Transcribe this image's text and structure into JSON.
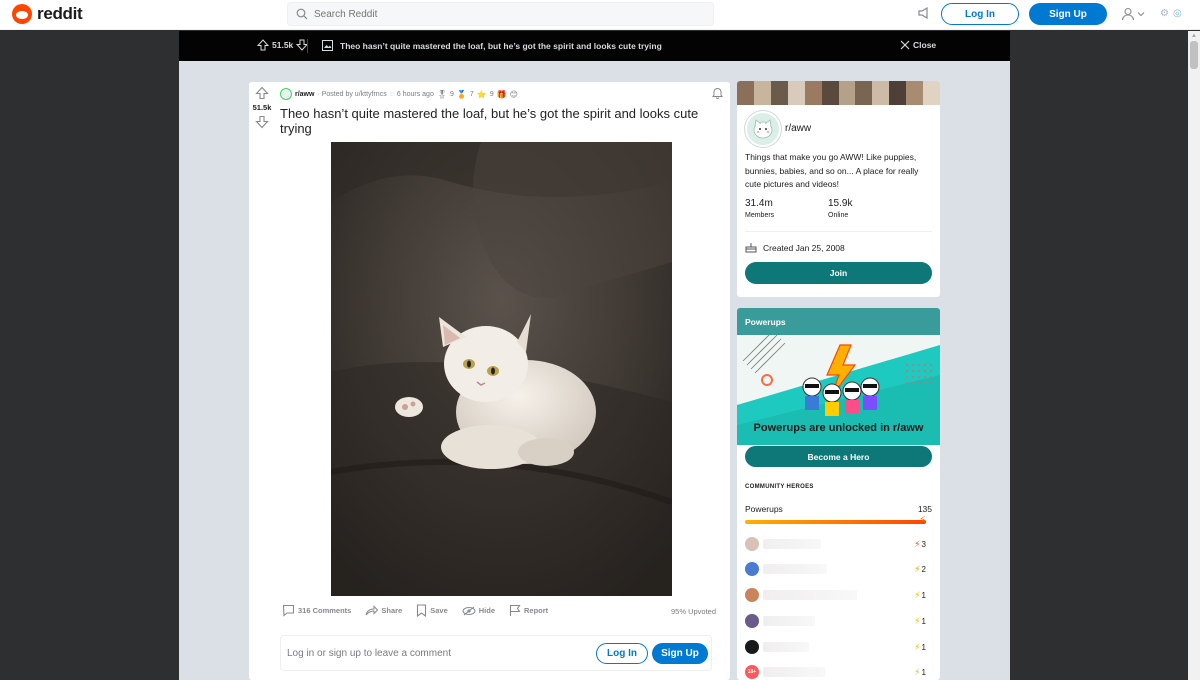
{
  "header": {
    "logo_text": "reddit",
    "search_placeholder": "Search Reddit",
    "login_label": "Log In",
    "signup_label": "Sign Up"
  },
  "postbar": {
    "votes": "51.5k",
    "title": "Theo hasn’t quite mastered the loaf, but he’s got the spirit and looks cute trying",
    "close_label": "Close"
  },
  "post": {
    "votes": "51.5k",
    "subreddit": "r/aww",
    "posted_by": "· Posted by u/kttyfrncs",
    "time": "6 hours ago",
    "awards": [
      {
        "icon": "award-1-icon",
        "count": "9"
      },
      {
        "icon": "award-2-icon",
        "count": "7"
      },
      {
        "icon": "award-3-icon",
        "count": "9"
      }
    ],
    "title": "Theo hasn’t quite mastered the loaf, but he’s got the spirit and looks cute trying",
    "actions": {
      "comments": "316 Comments",
      "share": "Share",
      "save": "Save",
      "hide": "Hide",
      "report": "Report"
    },
    "upvoted": "95% Upvoted",
    "comment_prompt": "Log in or sign up to leave a comment",
    "login_label": "Log In",
    "signup_label": "Sign Up"
  },
  "community": {
    "name": "r/aww",
    "description": "Things that make you go AWW! Like puppies, bunnies, babies, and so on... A place for really cute pictures and videos!",
    "members_value": "31.4m",
    "members_label": "Members",
    "online_value": "15.9k",
    "online_label": "Online",
    "created": "Created Jan 25, 2008",
    "join_label": "Join"
  },
  "powerups": {
    "title": "Powerups",
    "unlocked_text": "Powerups are unlocked in r/aww",
    "hero_button": "Become a Hero",
    "heroes_title": "COMMUNITY HEROES",
    "row_label": "Powerups",
    "row_value": "135",
    "progress": 1.0,
    "heroes": [
      {
        "count": "3",
        "avatar_color": "#d9c2b5"
      },
      {
        "count": "2",
        "avatar_color": "#4a7bd1"
      },
      {
        "count": "1",
        "avatar_color": "#c9845a"
      },
      {
        "count": "1",
        "avatar_color": "#6b5b8a"
      },
      {
        "count": "1",
        "avatar_color": "#1a1a1a"
      },
      {
        "count": "1",
        "avatar_color": "#ff585b"
      }
    ],
    "nsfw_badge": "18+"
  },
  "colors": {
    "accent_blue": "#0079d3",
    "teal": "#0e7878",
    "reddit_orange": "#ff4500"
  }
}
